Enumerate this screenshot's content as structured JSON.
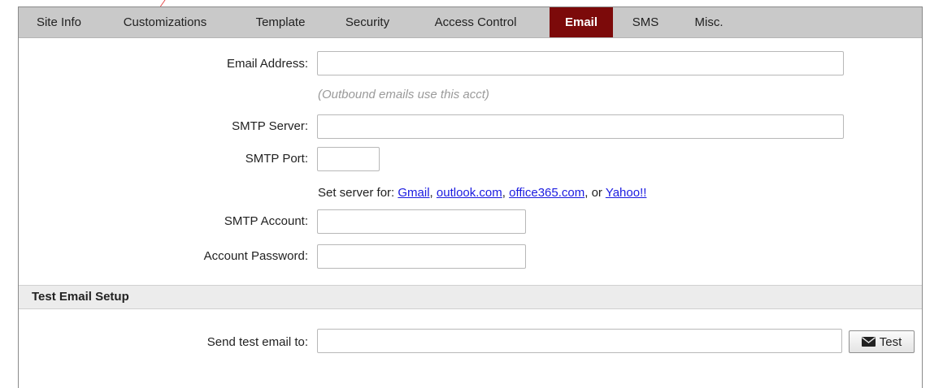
{
  "tabs": [
    {
      "label": "Site Info",
      "active": false
    },
    {
      "label": "Customizations",
      "active": false
    },
    {
      "label": "Template",
      "active": false
    },
    {
      "label": "Security",
      "active": false
    },
    {
      "label": "Access Control",
      "active": false
    },
    {
      "label": "Email",
      "active": true
    },
    {
      "label": "SMS",
      "active": false
    },
    {
      "label": "Misc.",
      "active": false
    }
  ],
  "colors": {
    "active_tab": "#7c0a0a",
    "tab_bar": "#c9c9c9",
    "link": "#1a1ae0",
    "hint": "#9a9a9a"
  },
  "email_form": {
    "email_address_label": "Email Address:",
    "email_address_value": "",
    "email_hint": "(Outbound emails use this acct)",
    "smtp_server_label": "SMTP Server:",
    "smtp_server_value": "",
    "smtp_port_label": "SMTP Port:",
    "smtp_port_value": "",
    "set_server_prefix": "Set server for:",
    "providers": [
      "Gmail",
      "outlook.com",
      "office365.com",
      "Yahoo!!"
    ],
    "separator_comma": ",",
    "separator_or": ", or",
    "smtp_account_label": "SMTP Account:",
    "smtp_account_value": "",
    "account_password_label": "Account Password:",
    "account_password_value": ""
  },
  "test_section": {
    "title": "Test Email Setup",
    "send_to_label": "Send test email to:",
    "send_to_value": "",
    "test_button_label": "Test",
    "test_button_icon": "envelope-icon"
  }
}
